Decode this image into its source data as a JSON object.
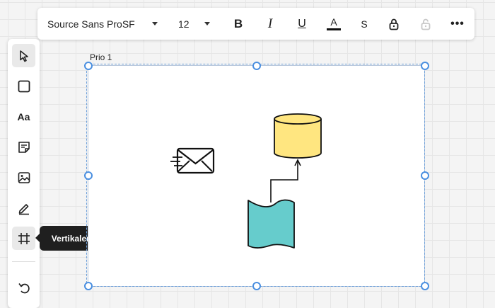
{
  "toolbar": {
    "font_family": "Source Sans ProSF",
    "font_size": "12",
    "bold_label": "B",
    "italic_label": "I",
    "underline_label": "U",
    "text_color_label": "A",
    "strike_label": "S",
    "more_label": "•••",
    "text_color": "#111111"
  },
  "tools": {
    "text_label": "Aa"
  },
  "tooltip": {
    "text": "Vertikaler Container"
  },
  "container": {
    "label": "Prio 1"
  },
  "colors": {
    "selection": "#4a8fe0",
    "database_fill": "#ffe680",
    "document_fill": "#66cccc"
  },
  "icons": {
    "pointer": "pointer-icon",
    "shape": "rectangle-icon",
    "note": "sticky-note-icon",
    "image": "image-icon",
    "pen": "pen-icon",
    "container": "frame-icon",
    "undo": "undo-icon"
  }
}
